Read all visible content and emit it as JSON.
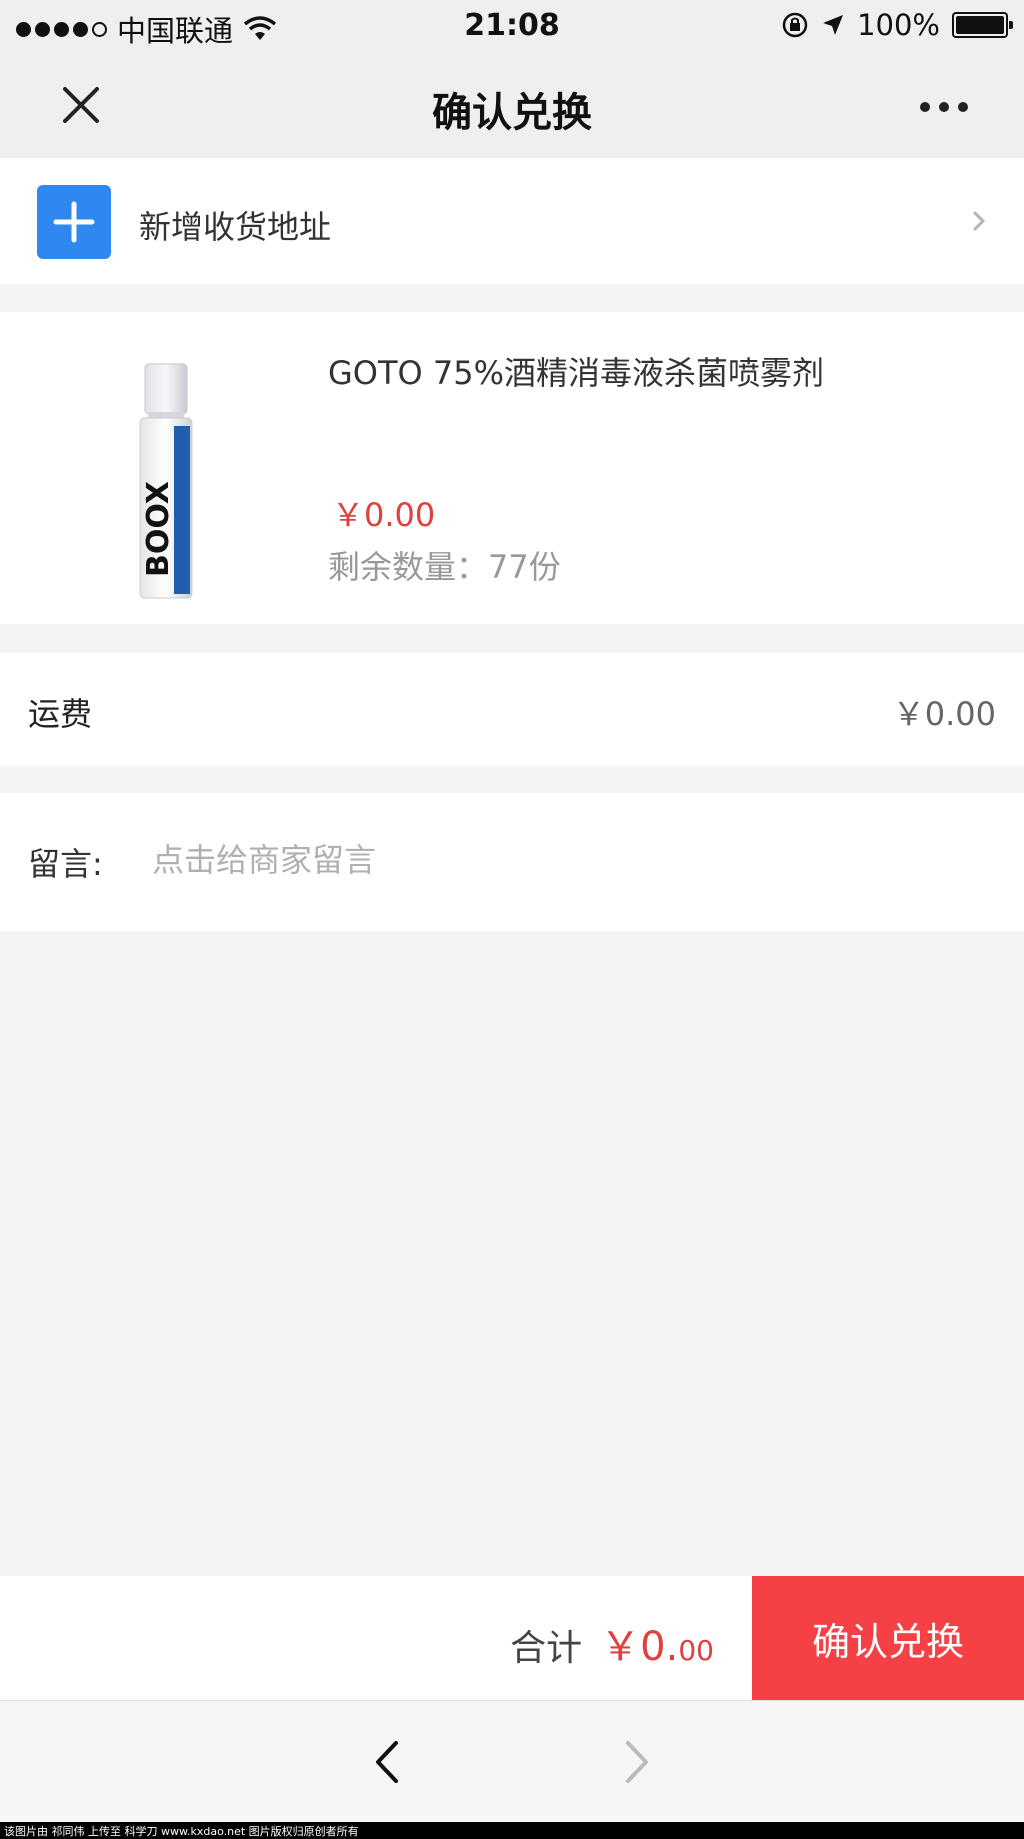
{
  "status_bar": {
    "carrier": "中国联通",
    "time": "21:08",
    "battery": "100%",
    "icons": [
      "signal-dots-icon",
      "wifi-icon",
      "orientation-lock-icon",
      "location-arrow-icon",
      "battery-icon"
    ]
  },
  "nav": {
    "title": "确认兑换",
    "close_icon": "close-icon",
    "more_icon": "more-icon"
  },
  "address": {
    "label": "新增收货地址",
    "icon": "plus-icon",
    "accent": "#2f88f0"
  },
  "product": {
    "name": "GOTO 75%酒精消毒液杀菌喷雾剂",
    "price": "￥0.00",
    "stock": "剩余数量：77份",
    "image_text": "BOOX"
  },
  "freight": {
    "label": "运费",
    "value": "￥0.00"
  },
  "message": {
    "label": "留言:",
    "placeholder": "点击给商家留言"
  },
  "footer": {
    "total_label": "合计",
    "total_amount": "￥0.",
    "total_cents": "00",
    "confirm_label": "确认兑换",
    "accent": "#f54146",
    "price_color": "#e0413e"
  },
  "browser": {
    "back_icon": "back-arrow-icon",
    "forward_icon": "forward-arrow-icon"
  },
  "credit": "该图片由 祁同伟 上传至 科学刀 www.kxdao.net 图片版权归原创者所有"
}
